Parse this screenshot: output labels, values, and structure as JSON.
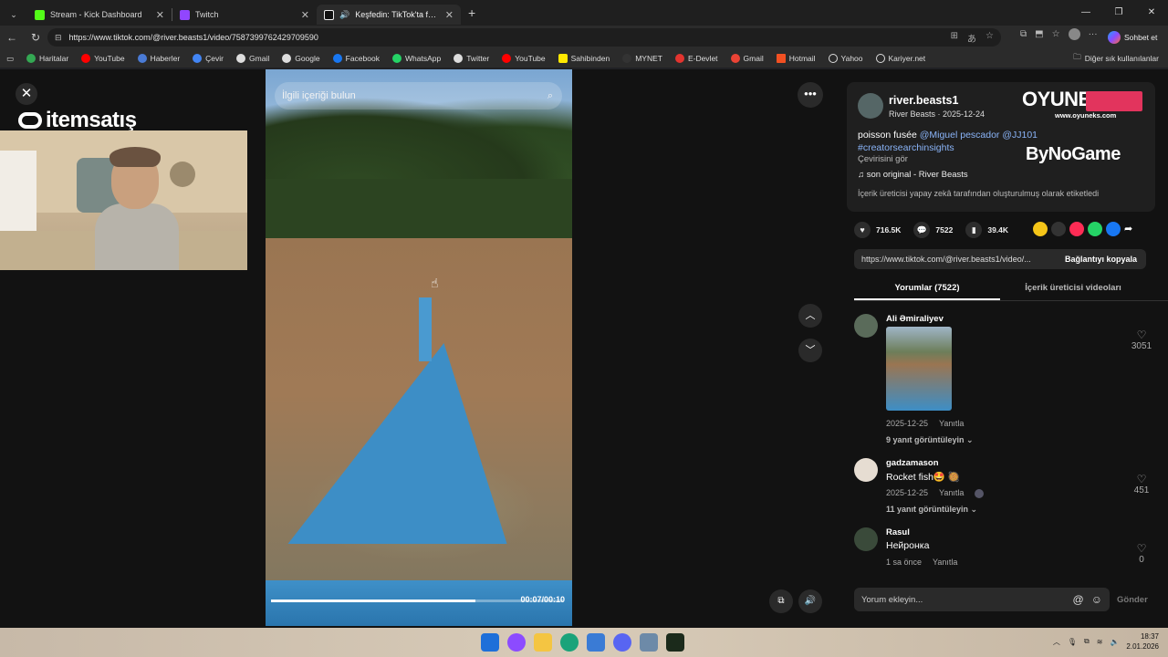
{
  "browser": {
    "tabs": [
      {
        "title": "Stream - Kick Dashboard",
        "icon": "kick-icon",
        "color": "#53fc18",
        "active": false
      },
      {
        "title": "Twitch",
        "icon": "twitch-icon",
        "color": "#9146ff",
        "active": false
      },
      {
        "title": "Keşfedin: TikTok'ta favori videolarınızı bulun",
        "icon": "tiktok-icon",
        "color": "#ffffff",
        "active": true
      }
    ],
    "url": "https://www.tiktok.com/@river.beasts1/video/7587399762429709590",
    "sohbet_label": "Sohbet et",
    "bookmarks": [
      {
        "label": "Haritalar",
        "color": "#34a853"
      },
      {
        "label": "YouTube",
        "color": "#ff0000"
      },
      {
        "label": "Haberler",
        "color": "#4a7bd6"
      },
      {
        "label": "Çevir",
        "color": "#4285f4"
      },
      {
        "label": "Gmail",
        "color": "#dddddd"
      },
      {
        "label": "Google",
        "color": "#dddddd"
      },
      {
        "label": "Facebook",
        "color": "#1877f2"
      },
      {
        "label": "WhatsApp",
        "color": "#25d366"
      },
      {
        "label": "Twitter",
        "color": "#dddddd"
      },
      {
        "label": "YouTube",
        "color": "#ff0000"
      },
      {
        "label": "Sahibinden",
        "color": "#ffe800"
      },
      {
        "label": "MYNET",
        "color": "#333333"
      },
      {
        "label": "E-Devlet",
        "color": "#e3342f"
      },
      {
        "label": "Gmail",
        "color": "#ea4335"
      },
      {
        "label": "Hotmail",
        "color": "#f25022"
      },
      {
        "label": "Yahoo",
        "color": "#dddddd"
      },
      {
        "label": "Kariyer.net",
        "color": "#dddddd"
      }
    ],
    "other_favorites": "Diğer sık kullanılanlar"
  },
  "overlay": {
    "itemsatis": "itemsatış",
    "oyuneks": "OYUNEKS",
    "oyuneks_site": "www.oyuneks.com",
    "bynogame": "ByNoGame"
  },
  "video": {
    "search_placeholder": "İlgili içeriği bulun",
    "time": "00:07/00:10",
    "progress": 0.7
  },
  "post": {
    "username": "river.beasts1",
    "subline": "River Beasts · 2025-12-24",
    "desc_text": "poisson fusée ",
    "mention1": "@Miguel pescador",
    "mention2": " @JJ101",
    "hashtag": "#creatorsearchinsights",
    "see_translation": "Çevirisini gör",
    "sound": "son original - River Beasts",
    "ai_label": "İçerik üreticisi yapay zekâ tarafından oluşturulmuş olarak etiketledi",
    "likes": "716.5K",
    "comments": "7522",
    "saves": "39.4K",
    "link_url": "https://www.tiktok.com/@river.beasts1/video/...",
    "copy_label": "Bağlantıyı kopyala",
    "tab_comments": "Yorumlar (7522)",
    "tab_creator": "İçerik üreticisi videoları"
  },
  "comments": [
    {
      "name": "Ali Əmiraliyev",
      "text": "",
      "date": "2025-12-25",
      "reply": "Yanıtla",
      "replies": "9 yanıt görüntüleyin",
      "likes": "3051"
    },
    {
      "name": "gadzamason",
      "text": "Rocket fish🤩 🥘",
      "date": "2025-12-25",
      "reply": "Yanıtla",
      "replies": "11 yanıt görüntüleyin",
      "likes": "451"
    },
    {
      "name": "Rasul",
      "text": "Нейронка",
      "date": "1 sa önce",
      "reply": "Yanıtla",
      "replies": "",
      "likes": "0"
    }
  ],
  "comment_input": {
    "placeholder": "Yorum ekleyin...",
    "send": "Gönder"
  },
  "taskbar": {
    "time": "18:37",
    "date": "2.01.2026"
  }
}
